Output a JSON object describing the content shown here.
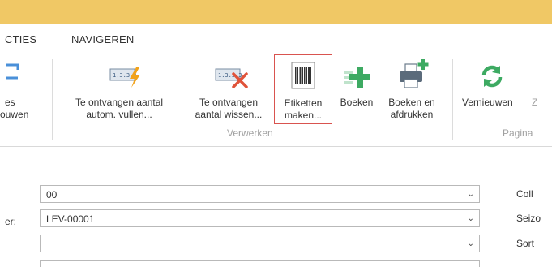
{
  "tabs": [
    {
      "label": "CTIES"
    },
    {
      "label": "NAVIGEREN"
    }
  ],
  "ribbon": {
    "left_partial": {
      "line1": "es",
      "line2": "ouwen"
    },
    "btn_fill": {
      "line1": "Te ontvangen aantal",
      "line2": "autom. vullen..."
    },
    "btn_clear": {
      "line1": "Te ontvangen",
      "line2": "aantal wissen..."
    },
    "btn_labels": {
      "line1": "Etiketten",
      "line2": "maken..."
    },
    "btn_post": {
      "line1": "Boeken"
    },
    "btn_post_print": {
      "line1": "Boeken en",
      "line2": "afdrukken"
    },
    "btn_refresh": {
      "line1": "Vernieuwen",
      "suffix": "Z"
    },
    "group_process": "Verwerken",
    "group_page": "Pagina"
  },
  "form": {
    "row1": {
      "label": "",
      "value": "00",
      "right_label": "Coll"
    },
    "row2": {
      "label": "er:",
      "value": "LEV-00001",
      "right_label": "Seizo"
    },
    "row3": {
      "label": "",
      "value": "",
      "right_label": "Sort"
    },
    "row4": {
      "label": "",
      "value": ""
    }
  },
  "icons": {
    "chevron": "⌄",
    "fill_icon": "lightning-icon",
    "clear_icon": "x-icon",
    "barcode_icon": "barcode-icon",
    "post_icon": "plus-icon",
    "print_icon": "printer-plus-icon",
    "refresh_icon": "refresh-icon"
  },
  "colors": {
    "titlebar": "#f0c865",
    "accent_green": "#3daa62",
    "highlight_border": "#d9534f",
    "lightning": "#f2a31b",
    "clear_x": "#e0533a"
  }
}
